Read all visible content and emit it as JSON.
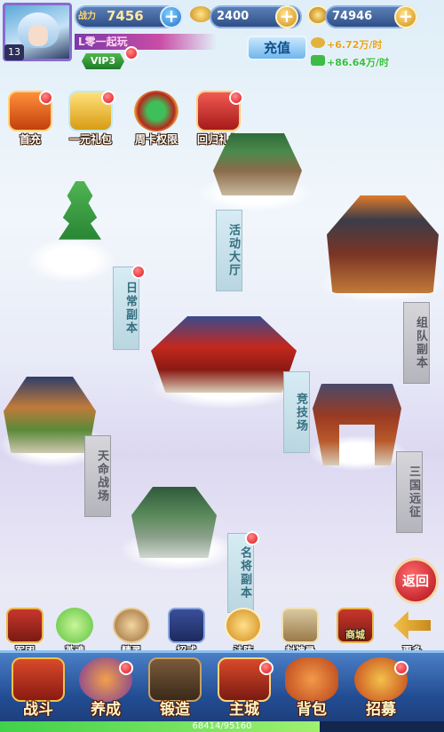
{
  "player": {
    "level": "13",
    "power_label": "战力",
    "power": "7456",
    "name": "L零一起玩",
    "vip": "VIP3"
  },
  "currency": {
    "silver": "2400",
    "gold": "74946"
  },
  "charge": {
    "label": "充值"
  },
  "rates": {
    "gold_rate": "+6.72万/时",
    "silver_rate": "+86.64万/时"
  },
  "events": [
    {
      "label": "首充"
    },
    {
      "label": "一元礼包"
    },
    {
      "label": "周卡权限"
    },
    {
      "label": "回归礼包"
    }
  ],
  "buildings": {
    "activity_hall": "活动大厅",
    "daily_dungeon": "日常副本",
    "team_dungeon": "组队副本",
    "arena": "竞技场",
    "fate_battlefield": "天命战场",
    "three_kingdoms": "三国远征",
    "general_dungeon": "名将副本"
  },
  "back": {
    "label": "返回"
  },
  "submenu": [
    {
      "label": "军团"
    },
    {
      "label": "英魂"
    },
    {
      "label": "精灵"
    },
    {
      "label": "招式"
    },
    {
      "label": "法阵"
    },
    {
      "label": "封神录"
    },
    {
      "label": "商城"
    },
    {
      "label": "更多"
    }
  ],
  "dock": [
    {
      "label": "战斗"
    },
    {
      "label": "养成"
    },
    {
      "label": "锻造"
    },
    {
      "label": "主城"
    },
    {
      "label": "背包"
    },
    {
      "label": "招募"
    }
  ],
  "exp": {
    "text": "68414/95160",
    "progress": 0.719
  },
  "colors": {
    "accent": "#2f4f87",
    "badge": "#e0141c",
    "rate": "#33c13a"
  }
}
